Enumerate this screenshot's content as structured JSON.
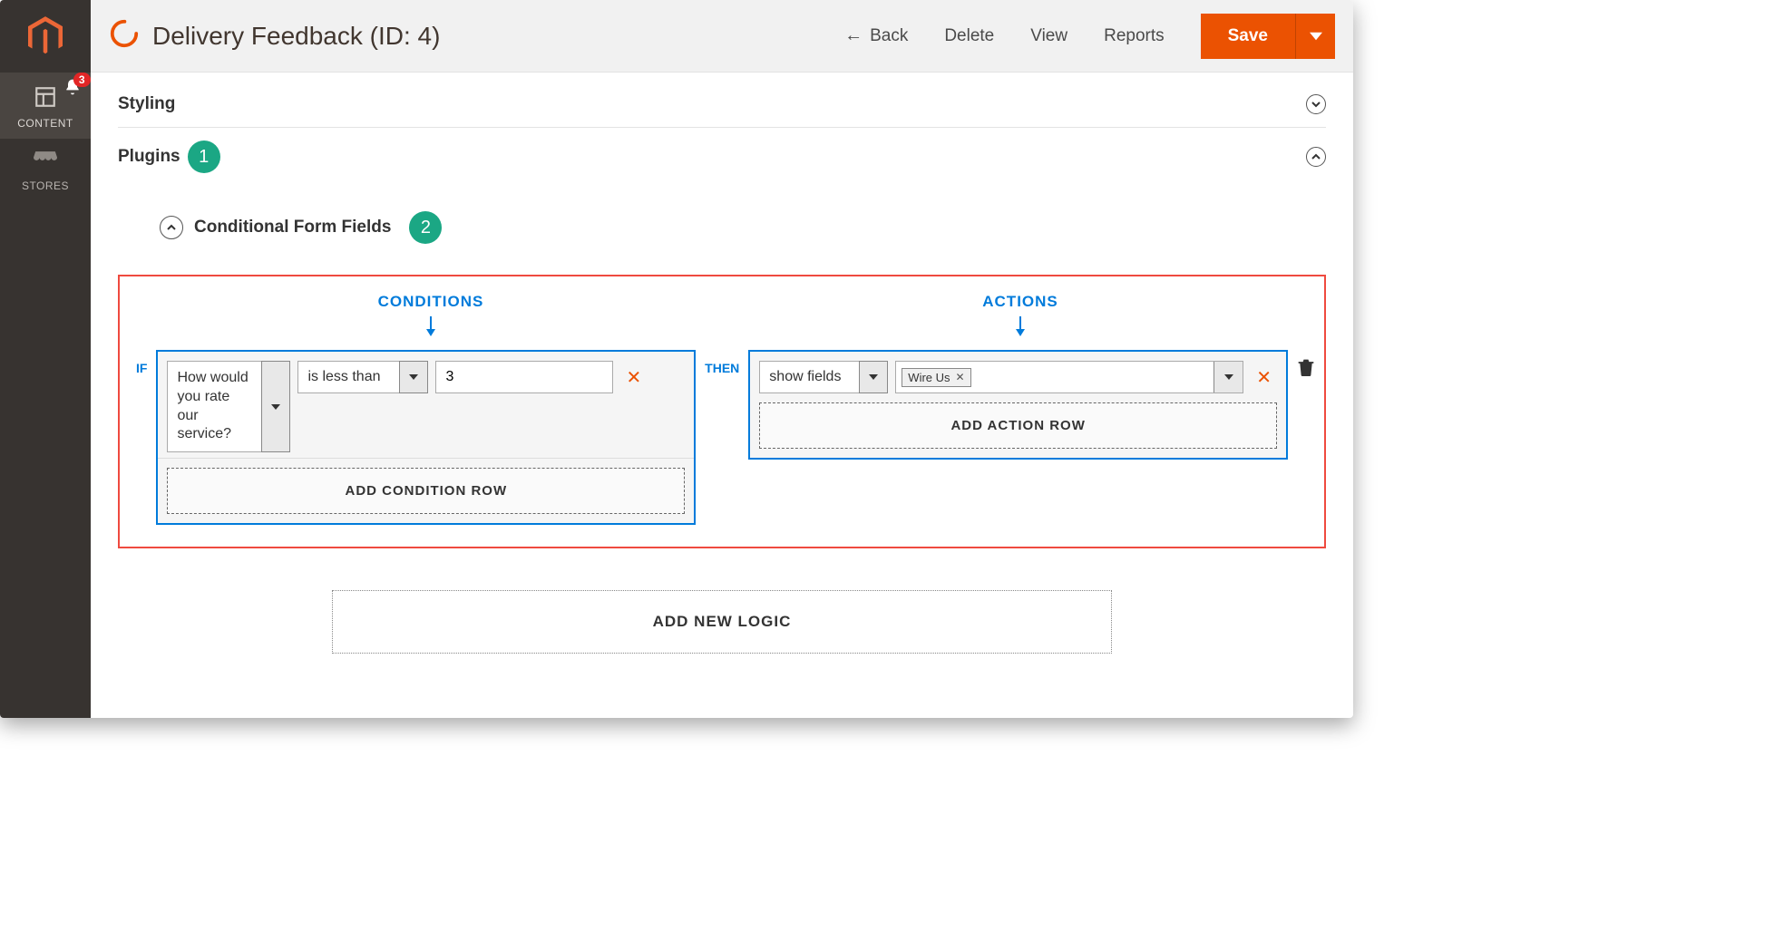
{
  "sidebar": {
    "items": [
      {
        "label": "CONTENT"
      },
      {
        "label": "STORES"
      }
    ],
    "badge_count": "3"
  },
  "header": {
    "title": "Delivery Feedback (ID: 4)",
    "back_label": "Back",
    "delete_label": "Delete",
    "view_label": "View",
    "reports_label": "Reports",
    "save_label": "Save"
  },
  "sections": {
    "styling_label": "Styling",
    "plugins_label": "Plugins",
    "conditional_label": "Conditional Form Fields"
  },
  "callouts": {
    "plugins": "1",
    "conditional": "2"
  },
  "logic": {
    "conditions_heading": "CONDITIONS",
    "actions_heading": "ACTIONS",
    "if_kw": "IF",
    "then_kw": "THEN",
    "condition": {
      "field": "How would you rate our service?",
      "operator": "is less than",
      "value": "3"
    },
    "action": {
      "type": "show fields",
      "target_tag": "Wire Us"
    },
    "add_condition_row": "ADD CONDITION ROW",
    "add_action_row": "ADD ACTION ROW",
    "add_new_logic": "ADD NEW LOGIC"
  }
}
